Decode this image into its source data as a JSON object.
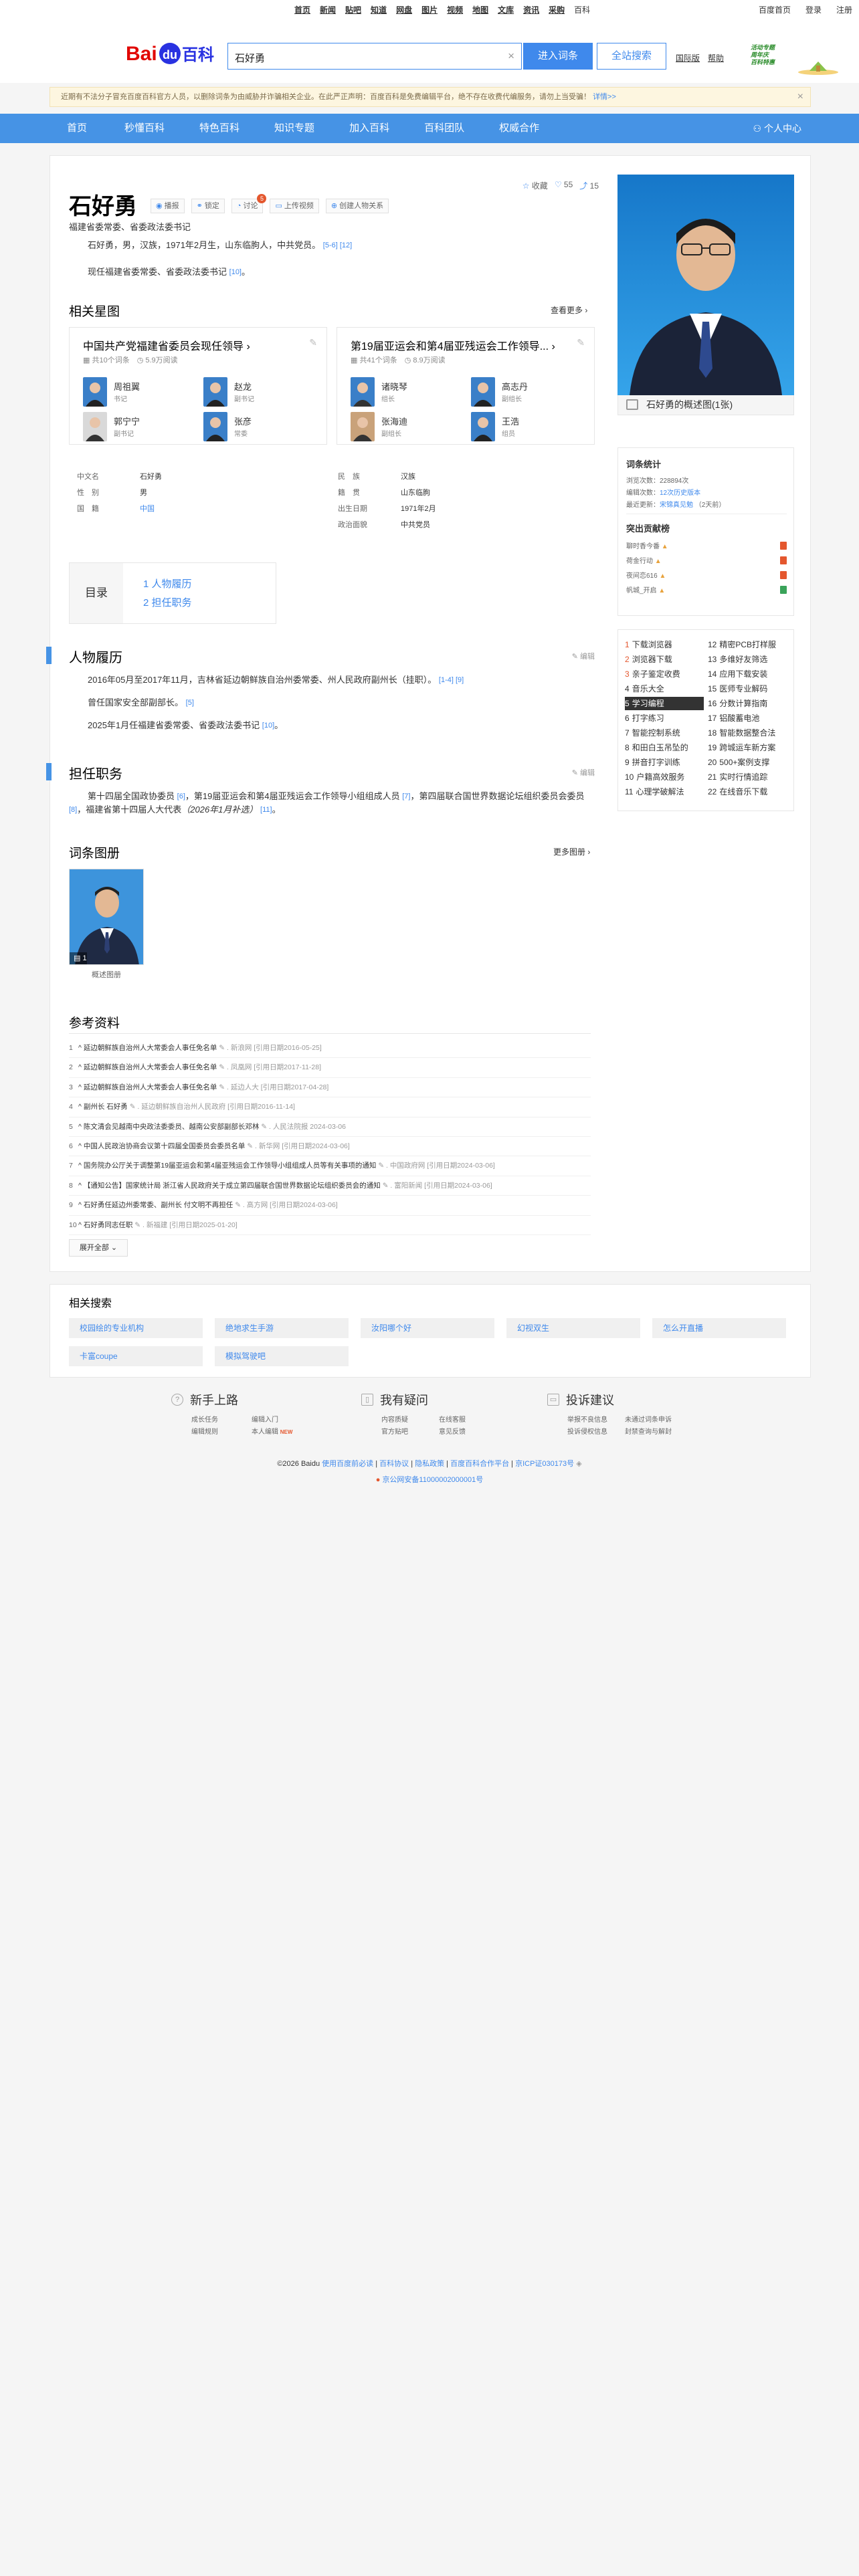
{
  "topnav": {
    "items": [
      "首页",
      "新闻",
      "贴吧",
      "知道",
      "网盘",
      "图片",
      "视频",
      "地图",
      "文库",
      "资讯",
      "采购",
      "百科"
    ],
    "right": [
      "百度首页",
      "登录",
      "注册"
    ]
  },
  "search": {
    "logo_text": "Bai百科",
    "logo_du": "du",
    "query": "石好勇",
    "clear_icon": "×",
    "enter_label": "进入词条",
    "all_label": "全站搜索",
    "links": [
      "国际版",
      "帮助"
    ],
    "promo": "活动专题 周年庆 百科特惠"
  },
  "notice": {
    "text": "近期有不法分子冒充百度百科官方人员，以删除词条为由威胁并诈骗相关企业。在此严正声明：百度百科是免费编辑平台，绝不存在收费代编服务，请勿上当受骗！",
    "link": "详情>>",
    "close": "×"
  },
  "mainnav": {
    "items": [
      "首页",
      "秒懂百科",
      "特色百科",
      "知识专题",
      "加入百科",
      "百科团队",
      "权威合作"
    ],
    "user": "个人中心"
  },
  "entry": {
    "title": "石好勇",
    "tools": [
      {
        "icon": "◉",
        "label": "播报"
      },
      {
        "icon": "⚭",
        "label": "锁定"
      },
      {
        "icon": "◔",
        "label": "讨论",
        "badge": "5"
      },
      {
        "icon": "▭",
        "label": "上传视频"
      },
      {
        "icon": "⊕",
        "label": "创建人物关系"
      }
    ],
    "stats": {
      "fav": "收藏",
      "likes": "55",
      "shares": "15"
    },
    "subtitle": "福建省委常委、省委政法委书记",
    "summary1": "石好勇，男，汉族，1971年2月生，山东临朐人，中共党员。",
    "summary1_refs": "[5-6] [12]",
    "summary2": "现任福建省委常委、省委政法委书记",
    "summary2_refs": "[10]"
  },
  "star_map": {
    "title": "相关星图",
    "more": "查看更多",
    "cards": [
      {
        "title": "中国共产党福建省委员会现任领导",
        "meta1": "共10个词条",
        "meta2": "5.9万阅读",
        "people": [
          {
            "name": "周祖翼",
            "role": "书记"
          },
          {
            "name": "赵龙",
            "role": "副书记"
          },
          {
            "name": "郭宁宁",
            "role": "副书记"
          },
          {
            "name": "张彦",
            "role": "常委"
          }
        ]
      },
      {
        "title": "第19届亚运会和第4届亚残运会工作领导...",
        "meta1": "共41个词条",
        "meta2": "8.9万阅读",
        "people": [
          {
            "name": "诸晓琴",
            "role": "组长"
          },
          {
            "name": "高志丹",
            "role": "副组长"
          },
          {
            "name": "张海迪",
            "role": "副组长"
          },
          {
            "name": "王浩",
            "role": "组员"
          }
        ]
      }
    ]
  },
  "infobox": {
    "left": [
      {
        "k": "中文名",
        "v": "石好勇"
      },
      {
        "k": "性　别",
        "v": "男"
      },
      {
        "k": "国　籍",
        "v": "中国",
        "link": true
      }
    ],
    "right": [
      {
        "k": "民　族",
        "v": "汉族"
      },
      {
        "k": "籍　贯",
        "v": "山东临朐"
      },
      {
        "k": "出生日期",
        "v": "1971年2月"
      },
      {
        "k": "政治面貌",
        "v": "中共党员"
      }
    ]
  },
  "toc": {
    "title": "目录",
    "items": [
      "1  人物履历",
      "2  担任职务"
    ]
  },
  "resume": {
    "title": "人物履历",
    "edit": "编辑",
    "p1": "2016年05月至2017年11月，吉林省延边朝鲜族自治州委常委、州人民政府副州长（挂职）。",
    "p1_refs": "[1-4] [9]",
    "p2": "曾任国家安全部副部长。",
    "p2_refs": "[5]",
    "p3": "2025年1月任福建省委常委、省委政法委书记",
    "p3_refs": "[10]"
  },
  "positions": {
    "title": "担任职务",
    "edit": "编辑",
    "text_a": "第十四届全国政协委员",
    "ref_a": "[6]",
    "text_b": "，第19届亚运会和第4届亚残运会工作领导小组组成人员",
    "ref_b": "[7]",
    "text_c": "，第四届联合国世界数据论坛组织委员会委员",
    "ref_c": "[8]",
    "text_d": "，福建省第十四届人大代表",
    "italic": "（2026年1月补选）",
    "ref_d": "[11]"
  },
  "album": {
    "title": "词条图册",
    "more": "更多图册",
    "caption": "概述图册",
    "count": "1"
  },
  "refs": {
    "title": "参考资料",
    "items": [
      {
        "n": "1",
        "text": "延边朝鲜族自治州人大常委会人事任免名单",
        "src": "新浪网 [引用日期2016-05-25]"
      },
      {
        "n": "2",
        "text": "延边朝鲜族自治州人大常委会人事任免名单",
        "src": "凤凰网 [引用日期2017-11-28]"
      },
      {
        "n": "3",
        "text": "延边朝鲜族自治州人大常委会人事任免名单",
        "src": "延边人大 [引用日期2017-04-28]"
      },
      {
        "n": "4",
        "text": "副州长 石好勇",
        "src": "延边朝鲜族自治州人民政府 [引用日期2016-11-14]"
      },
      {
        "n": "5",
        "text": "陈文清会见越南中央政法委委员、越南公安部副部长邓林",
        "src": "人民法院报 2024-03-06"
      },
      {
        "n": "6",
        "text": "中国人民政治协商会议第十四届全国委员会委员名单",
        "src": "新华网 [引用日期2024-03-06]"
      },
      {
        "n": "7",
        "text": "国务院办公厅关于调整第19届亚运会和第4届亚残运会工作领导小组组成人员等有关事项的通知",
        "src": "中国政府网 [引用日期2024-03-06]"
      },
      {
        "n": "8",
        "text": "【通知公告】国家统计局 浙江省人民政府关于成立第四届联合国世界数据论坛组织委员会的通知",
        "src": "富阳新闻 [引用日期2024-03-06]"
      },
      {
        "n": "9",
        "text": "石好勇任延边州委常委、副州长 付文明不再担任",
        "src": "高方网 [引用日期2024-03-06]"
      },
      {
        "n": "10",
        "text": "石好勇同志任职",
        "src": "新福建 [引用日期2025-01-20]"
      }
    ],
    "expand": "展开全部"
  },
  "side": {
    "photo_caption": "石好勇的概述图(1张)",
    "stats_title": "词条统计",
    "views_label": "浏览次数：",
    "views": "228894次",
    "edits_label": "编辑次数：",
    "edits": "12次历史版本",
    "updated_label": "最近更新：",
    "updated_user": "宋锦真见勉",
    "updated_date": "（2天前）",
    "contrib_title": "突出贡献榜",
    "contrib": [
      "聊时香今番",
      "荷金行动",
      "夜间恋616",
      "帆城_开启"
    ],
    "ranks": [
      {
        "n": "1",
        "t": "下载浏览器"
      },
      {
        "n": "12",
        "t": "精密PCB打样服"
      },
      {
        "n": "2",
        "t": "浏览器下载"
      },
      {
        "n": "13",
        "t": "多维好友筛选"
      },
      {
        "n": "3",
        "t": "亲子鉴定收费"
      },
      {
        "n": "14",
        "t": "应用下载安装"
      },
      {
        "n": "4",
        "t": "音乐大全"
      },
      {
        "n": "15",
        "t": "医师专业解码"
      },
      {
        "n": "5",
        "t": "学习编程"
      },
      {
        "n": "16",
        "t": "分数计算指南"
      },
      {
        "n": "6",
        "t": "打字练习"
      },
      {
        "n": "17",
        "t": "铝酸蓄电池"
      },
      {
        "n": "7",
        "t": "智能控制系统"
      },
      {
        "n": "18",
        "t": "智能数据整合法"
      },
      {
        "n": "8",
        "t": "和田白玉吊坠的"
      },
      {
        "n": "19",
        "t": "跨城运车新方案"
      },
      {
        "n": "9",
        "t": "拼音打字训练"
      },
      {
        "n": "20",
        "t": "500+案例支撑"
      },
      {
        "n": "10",
        "t": "户籍高效服务"
      },
      {
        "n": "21",
        "t": "实时行情追踪"
      },
      {
        "n": "11",
        "t": "心理学破解法"
      },
      {
        "n": "22",
        "t": "在线音乐下载"
      }
    ]
  },
  "related": {
    "title": "相关搜索",
    "tags": [
      "校园绘的专业机构",
      "绝地求生手游",
      "汝阳哪个好",
      "幻视双生",
      "怎么开直播",
      "卡富coupe",
      "模拟驾驶吧"
    ]
  },
  "footer": {
    "cols": [
      {
        "title": "新手上路",
        "links": [
          "成长任务",
          "编辑入门",
          "编辑规则",
          "本人编辑"
        ]
      },
      {
        "title": "我有疑问",
        "links": [
          "内容质疑",
          "在线客服",
          "官方贴吧",
          "意见反馈"
        ]
      },
      {
        "title": "投诉建议",
        "links": [
          "举报不良信息",
          "未通过词条申诉",
          "投诉侵权信息",
          "封禁查询与解封"
        ]
      }
    ],
    "new_badge": "NEW",
    "copyright_pre": "©2026 Baidu",
    "copyright_links": [
      "使用百度前必读",
      "百科协议",
      "隐私政策",
      "百度百科合作平台",
      "京ICP证030173号"
    ],
    "icp": "京公网安备11000002000001号"
  },
  "colors": {
    "brand": "#4693e5",
    "link": "#3f89ec",
    "accent": "#e4572e"
  }
}
